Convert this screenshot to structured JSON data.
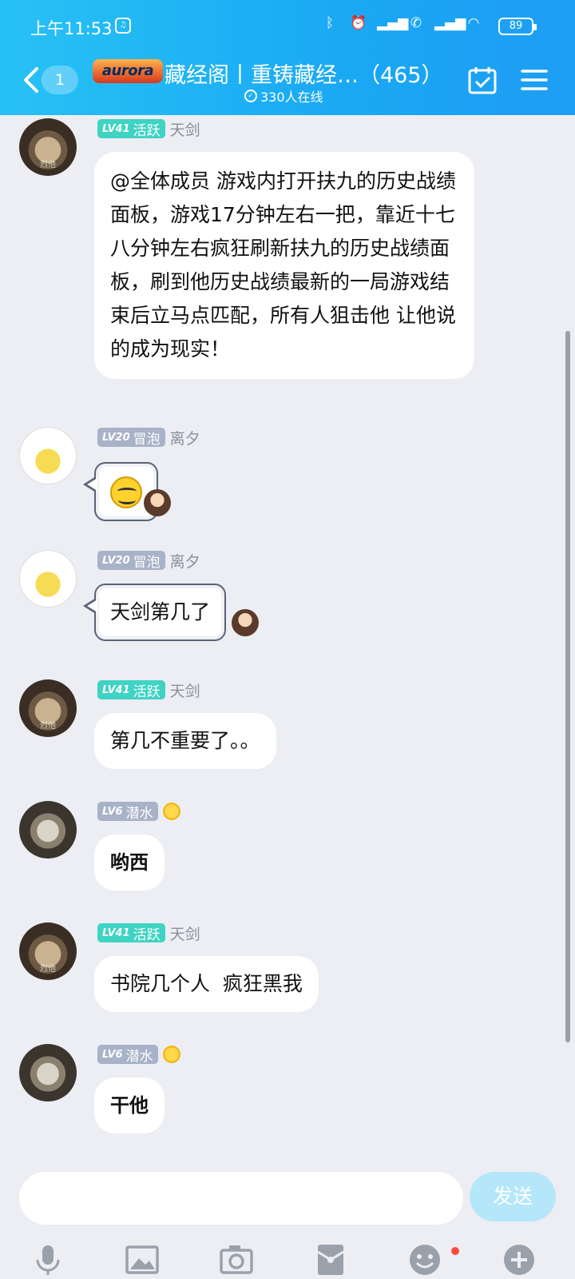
{
  "status_bar": {
    "time": "上午11:53",
    "battery": "89"
  },
  "header": {
    "unread_count": "1",
    "logo_text": "aurora",
    "title": "藏经阁丨重铸藏经…（465）",
    "online": "330人在线"
  },
  "messages": [
    {
      "level": "LV41",
      "rank": "活跃",
      "nick": "天剑",
      "text": "@全体成员 游戏内打开扶九的历史战绩面板，游戏17分钟左右一把，靠近十七八分钟左右疯狂刷新扶九的历史战绩面板，刷到他历史战绩最新的一局游戏结束后立马点匹配，所有人狙击他 让他说的成为现实！"
    },
    {
      "level": "LV20",
      "rank": "冒泡",
      "nick": "离夕",
      "text": ""
    },
    {
      "level": "LV20",
      "rank": "冒泡",
      "nick": "离夕",
      "text": "天剑第几了"
    },
    {
      "level": "LV41",
      "rank": "活跃",
      "nick": "天剑",
      "text": "第几不重要了。。"
    },
    {
      "level": "LV6",
      "rank": "潜水",
      "nick": "",
      "text": "哟西"
    },
    {
      "level": "LV41",
      "rank": "活跃",
      "nick": "天剑",
      "text": "书院几个人  疯狂黑我"
    },
    {
      "level": "LV6",
      "rank": "潜水",
      "nick": "",
      "text": "干他"
    }
  ],
  "input": {
    "placeholder": "",
    "send_label": "发送"
  },
  "avatar_watermark": "烈他"
}
